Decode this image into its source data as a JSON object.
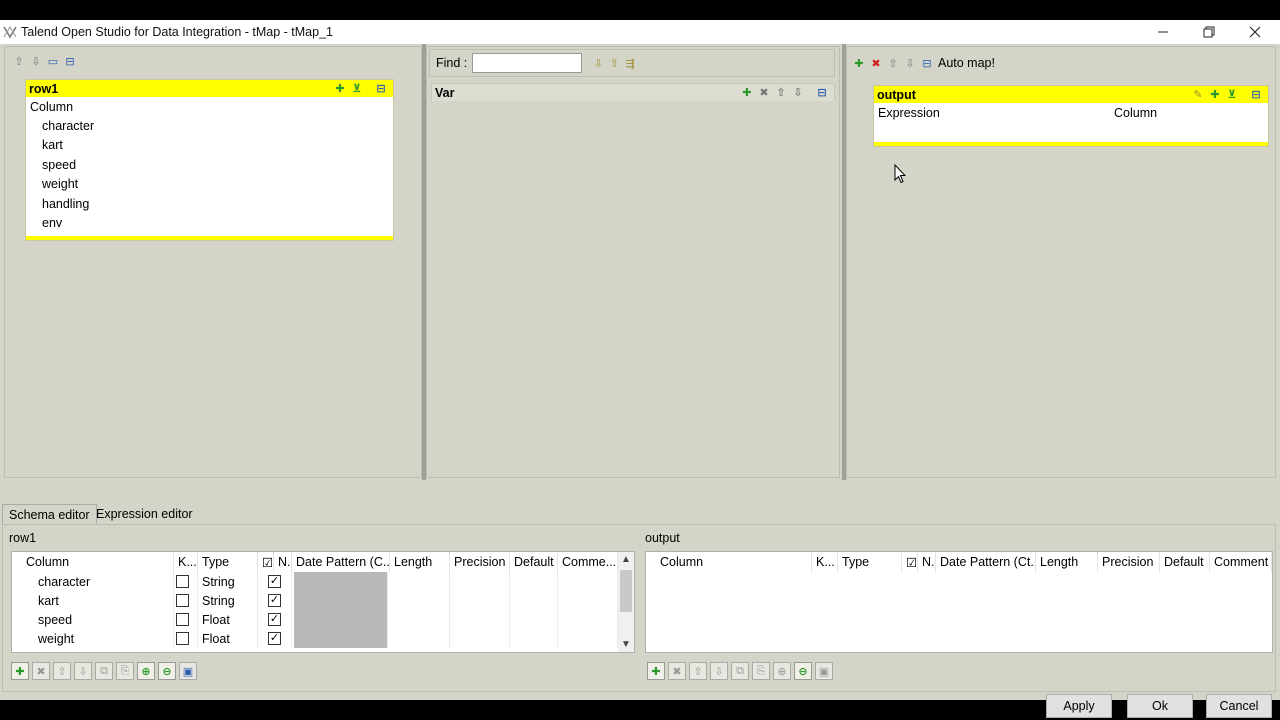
{
  "window": {
    "title": "Talend Open Studio for Data Integration - tMap - tMap_1"
  },
  "left_pane": {
    "input_table": {
      "name": "row1",
      "column_header": "Column",
      "columns": [
        "character",
        "kart",
        "speed",
        "weight",
        "handling",
        "env"
      ]
    }
  },
  "middle_pane": {
    "find_label": "Find :",
    "find_value": "",
    "var_table": {
      "name": "Var"
    }
  },
  "right_pane": {
    "auto_map_label": "Auto map!",
    "output_table": {
      "name": "output",
      "headers": [
        "Expression",
        "Column"
      ]
    }
  },
  "tabs": [
    {
      "label": "Schema editor",
      "active": true
    },
    {
      "label": "Expression editor",
      "active": false
    }
  ],
  "schema_left": {
    "title": "row1",
    "headers": [
      "Column",
      "K...",
      "Type",
      "☑",
      "N.",
      "Date Pattern (C...",
      "Length",
      "Precision",
      "Default",
      "Comme..."
    ],
    "rows": [
      {
        "column": "character",
        "type": "String",
        "key": false,
        "nullable": true
      },
      {
        "column": "kart",
        "type": "String",
        "key": false,
        "nullable": true
      },
      {
        "column": "speed",
        "type": "Float",
        "key": false,
        "nullable": true
      },
      {
        "column": "weight",
        "type": "Float",
        "key": false,
        "nullable": true
      }
    ]
  },
  "schema_right": {
    "title": "output",
    "headers": [
      "Column",
      "K...",
      "Type",
      "☑",
      "N.",
      "Date Pattern (Ct...",
      "Length",
      "Precision",
      "Default",
      "Comment"
    ]
  },
  "buttons": {
    "apply": "Apply",
    "ok": "Ok",
    "cancel": "Cancel"
  },
  "colors": {
    "table_header": "#ffff00",
    "panel_bg": "#d4d4c8"
  }
}
